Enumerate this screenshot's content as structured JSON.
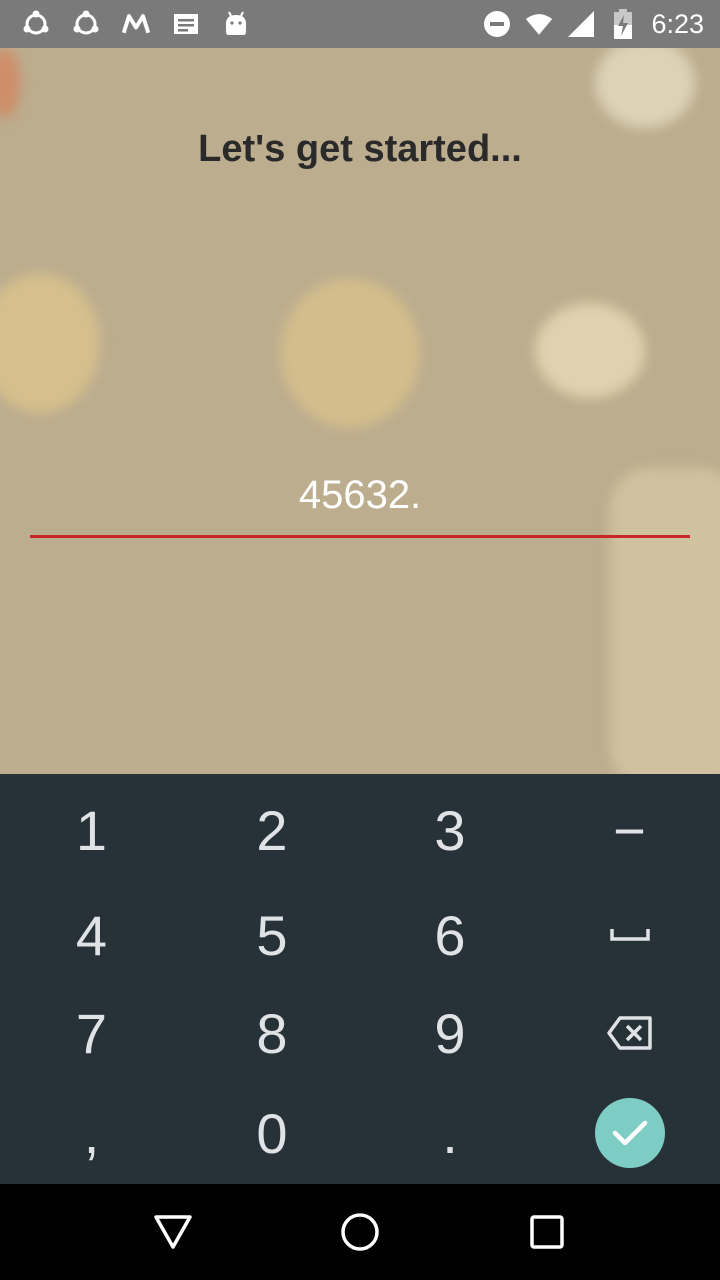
{
  "status_bar": {
    "time": "6:23",
    "left_icons": [
      "share-icon",
      "share-icon",
      "moto-icon",
      "news-icon",
      "android-icon"
    ],
    "right_icons": [
      "do-not-disturb-icon",
      "wifi-icon",
      "cell-signal-icon",
      "battery-charging-icon"
    ]
  },
  "main": {
    "title": "Let's get started...",
    "input_value": "45632.",
    "colors": {
      "underline": "#c62828",
      "caret": "#009688"
    }
  },
  "keyboard": {
    "row1": [
      "1",
      "2",
      "3",
      "−"
    ],
    "row2": [
      "4",
      "5",
      "6",
      "space-icon"
    ],
    "row3": [
      "7",
      "8",
      "9",
      "backspace-icon"
    ],
    "row4": [
      ",",
      "0",
      ".",
      "check-icon"
    ],
    "colors": {
      "background": "#263238",
      "enter": "#7ecdc4"
    }
  },
  "nav_bar": {
    "icons": [
      "back-icon",
      "home-icon",
      "recents-icon"
    ]
  }
}
